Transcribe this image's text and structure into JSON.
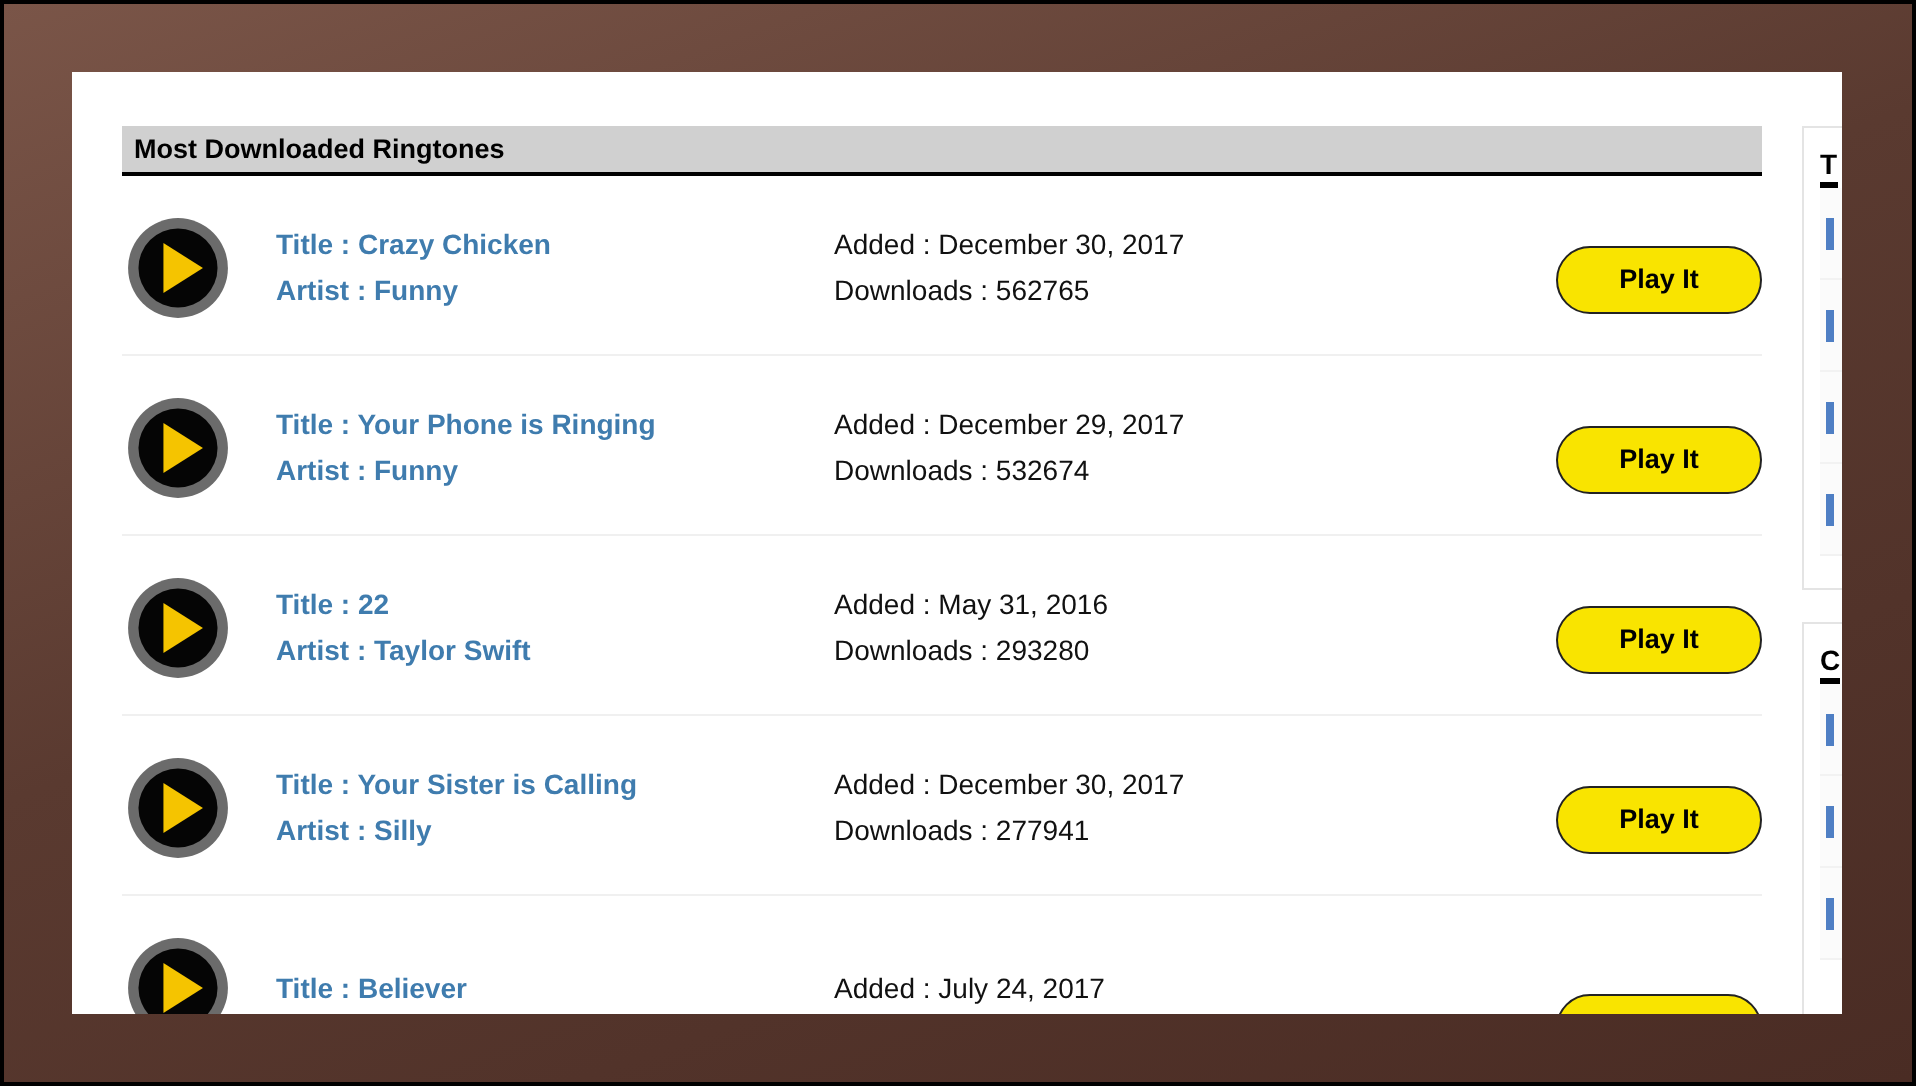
{
  "main": {
    "heading": "Most Downloaded Ringtones",
    "ringtones": [
      {
        "title": "Title : Crazy Chicken",
        "artist": "Artist : Funny",
        "added": "Added : December 30, 2017",
        "downloads": "Downloads : 562765",
        "button": "Play It"
      },
      {
        "title": "Title : Your Phone is Ringing",
        "artist": "Artist : Funny",
        "added": "Added : December 29, 2017",
        "downloads": "Downloads : 532674",
        "button": "Play It"
      },
      {
        "title": "Title : 22",
        "artist": "Artist : Taylor Swift",
        "added": "Added : May 31, 2016",
        "downloads": "Downloads : 293280",
        "button": "Play It"
      },
      {
        "title": "Title : Your Sister is Calling",
        "artist": "Artist : Silly",
        "added": "Added : December 30, 2017",
        "downloads": "Downloads : 277941",
        "button": "Play It"
      },
      {
        "title": "Title : Believer",
        "added": "Added : July 24, 2017"
      }
    ]
  },
  "sidebar": {
    "panels": [
      {
        "heading": "T"
      },
      {
        "heading": "C"
      }
    ]
  }
}
